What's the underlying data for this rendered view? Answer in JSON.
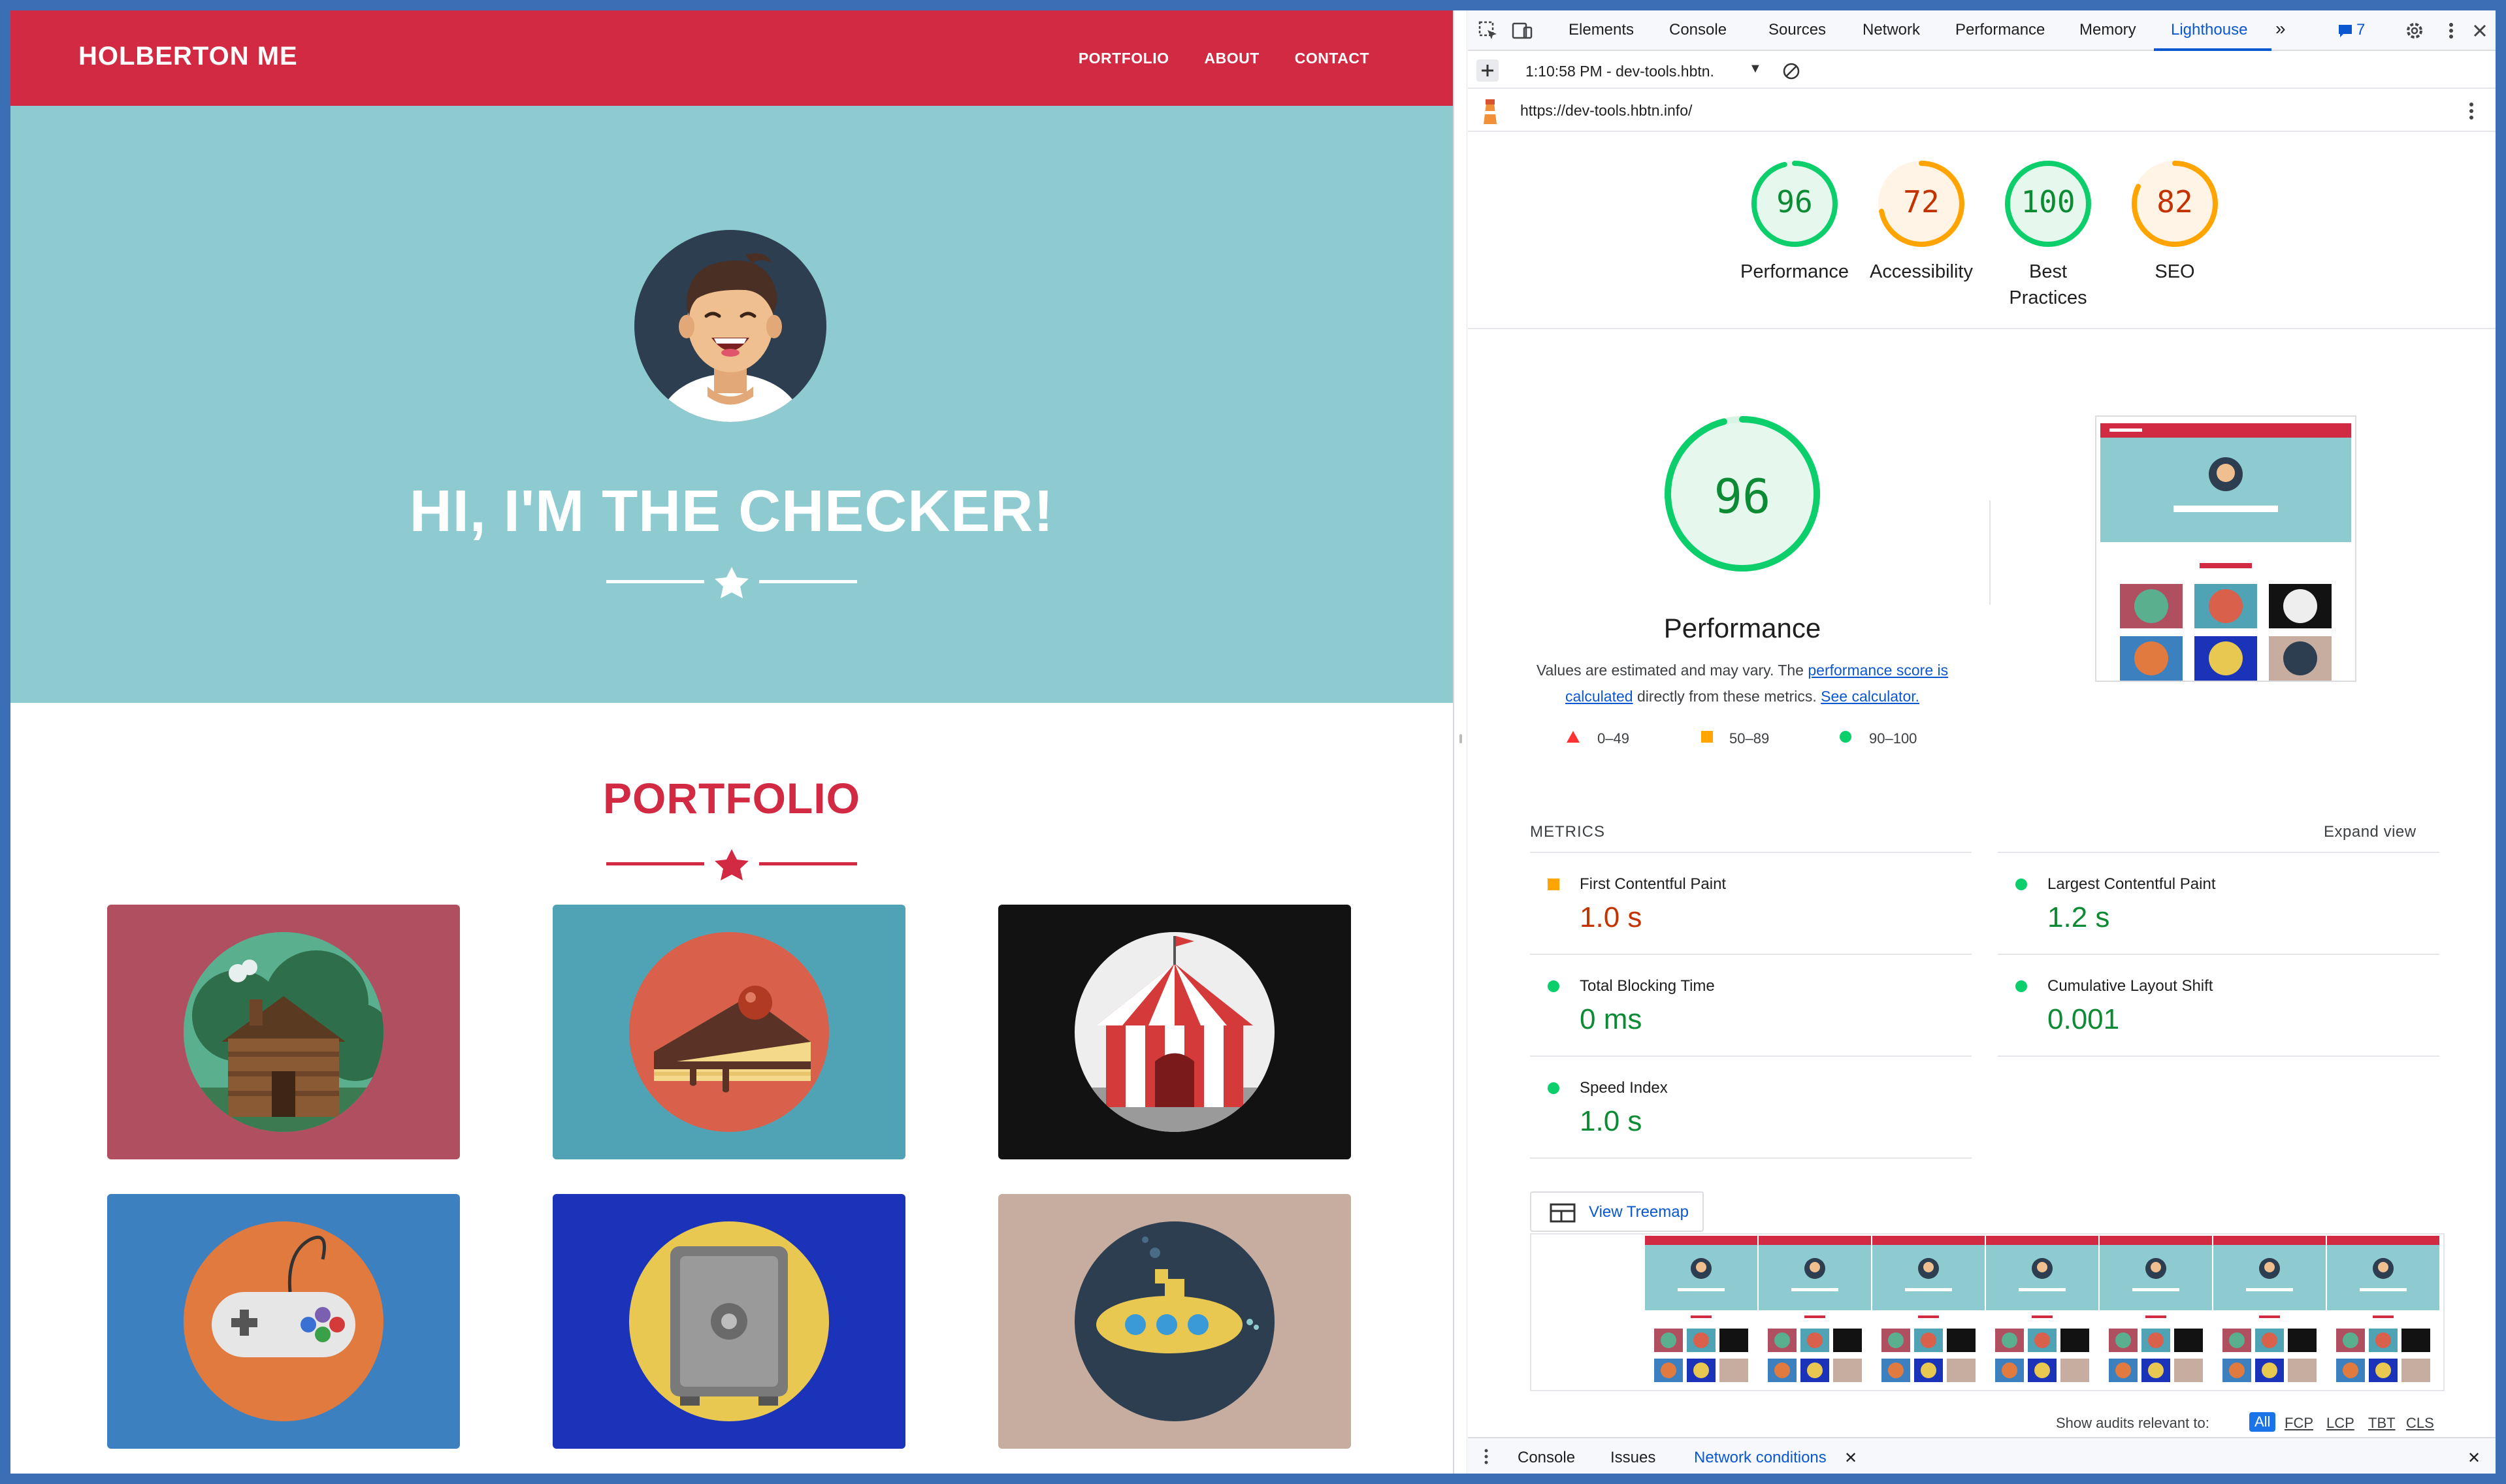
{
  "site": {
    "brand": "HOLBERTON ME",
    "nav": [
      "PORTFOLIO",
      "ABOUT",
      "CONTACT"
    ],
    "hero_title": "HI, I'M THE CHECKER!",
    "portfolio_title": "PORTFOLIO",
    "tiles": [
      {
        "name": "cabin",
        "bg": "#b04f60"
      },
      {
        "name": "cake",
        "bg": "#4fa3b5"
      },
      {
        "name": "circus",
        "bg": "#121212"
      },
      {
        "name": "controller",
        "bg": "#3d80c0"
      },
      {
        "name": "safe",
        "bg": "#1a33b8"
      },
      {
        "name": "submarine",
        "bg": "#c6ad9f"
      }
    ]
  },
  "devtools": {
    "tabs": [
      "Elements",
      "Console",
      "Sources",
      "Network",
      "Performance",
      "Memory",
      "Lighthouse"
    ],
    "active_tab": "Lighthouse",
    "issues_count": "7",
    "report_selector": "1:10:58 PM - dev-tools.hbtn.",
    "url": "https://dev-tools.hbtn.info/",
    "scores": [
      {
        "label": "Performance",
        "value": 96,
        "color": "#0cce6b"
      },
      {
        "label": "Accessibility",
        "value": 72,
        "color": "#ffa400"
      },
      {
        "label": "Best Practices",
        "value": 100,
        "color": "#0cce6b"
      },
      {
        "label": "SEO",
        "value": 82,
        "color": "#ffa400"
      }
    ],
    "perf_score": "96",
    "perf_label": "Performance",
    "note_prefix": "Values are estimated and may vary. The",
    "note_link1": "performance score is calculated",
    "note_mid": "directly from these metrics.",
    "note_link2": "See calculator.",
    "legend": [
      "0–49",
      "50–89",
      "90–100"
    ],
    "metrics_title": "METRICS",
    "expand_view": "Expand view",
    "metrics": [
      {
        "label": "First Contentful Paint",
        "value": "1.0 s",
        "status": "average"
      },
      {
        "label": "Largest Contentful Paint",
        "value": "1.2 s",
        "status": "pass"
      },
      {
        "label": "Total Blocking Time",
        "value": "0 ms",
        "status": "pass"
      },
      {
        "label": "Cumulative Layout Shift",
        "value": "0.001",
        "status": "pass"
      },
      {
        "label": "Speed Index",
        "value": "1.0 s",
        "status": "pass"
      }
    ],
    "treemap_label": "View Treemap",
    "filters_label": "Show audits relevant to:",
    "filters": [
      "All",
      "FCP",
      "LCP",
      "TBT",
      "CLS"
    ],
    "drawer_tabs": [
      "Console",
      "Issues",
      "Network conditions"
    ]
  }
}
